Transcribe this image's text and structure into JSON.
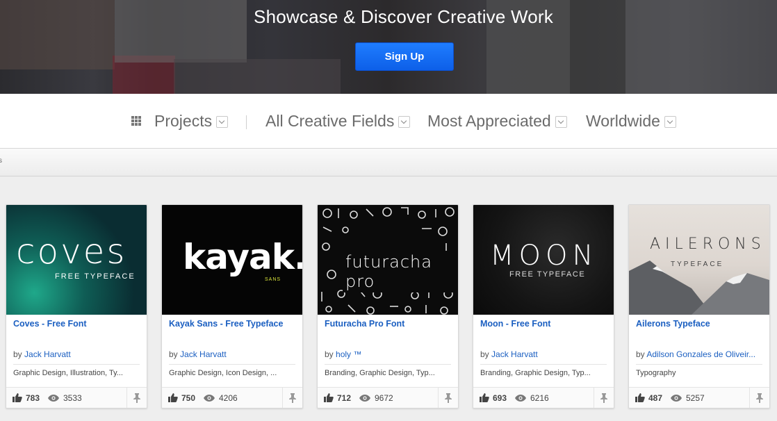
{
  "hero": {
    "title": "Showcase & Discover Creative Work",
    "signup_label": "Sign Up"
  },
  "filters": {
    "grid_icon": "grid-icon",
    "items": [
      {
        "label": "Projects"
      },
      {
        "label": "All Creative Fields"
      },
      {
        "label": "Most Appreciated"
      },
      {
        "label": "Worldwide"
      }
    ]
  },
  "subbar": {
    "text": "s"
  },
  "cards": [
    {
      "title": "Coves - Free Font",
      "by": "by",
      "author": "Jack Harvatt",
      "fields": "Graphic Design, Illustration, Ty...",
      "appreciations": "783",
      "views": "3533",
      "thumb_text": "coves",
      "thumb_sub": "FREE TYPEFACE"
    },
    {
      "title": "Kayak Sans - Free Typeface",
      "by": "by",
      "author": "Jack Harvatt",
      "fields": "Graphic Design, Icon Design, ...",
      "appreciations": "750",
      "views": "4206",
      "thumb_text": "kayak.",
      "thumb_sub": "SANS"
    },
    {
      "title": "Futuracha Pro Font",
      "by": "by",
      "author": "holy ™",
      "fields": "Branding, Graphic Design, Typ...",
      "appreciations": "712",
      "views": "9672",
      "thumb_text": "futuracha pro"
    },
    {
      "title": "Moon - Free Font",
      "by": "by",
      "author": "Jack Harvatt",
      "fields": "Branding, Graphic Design, Typ...",
      "appreciations": "693",
      "views": "6216",
      "thumb_text": "MOON",
      "thumb_sub": "FREE TYPEFACE"
    },
    {
      "title": "Ailerons Typeface",
      "by": "by",
      "author": "Adilson Gonzales de Oliveir...",
      "fields": "Typography",
      "appreciations": "487",
      "views": "5257",
      "thumb_text": "AILERONS",
      "thumb_sub": "TYPEFACE"
    }
  ],
  "colors": {
    "accent": "#1b5fc1",
    "signup": "#1470f5"
  }
}
